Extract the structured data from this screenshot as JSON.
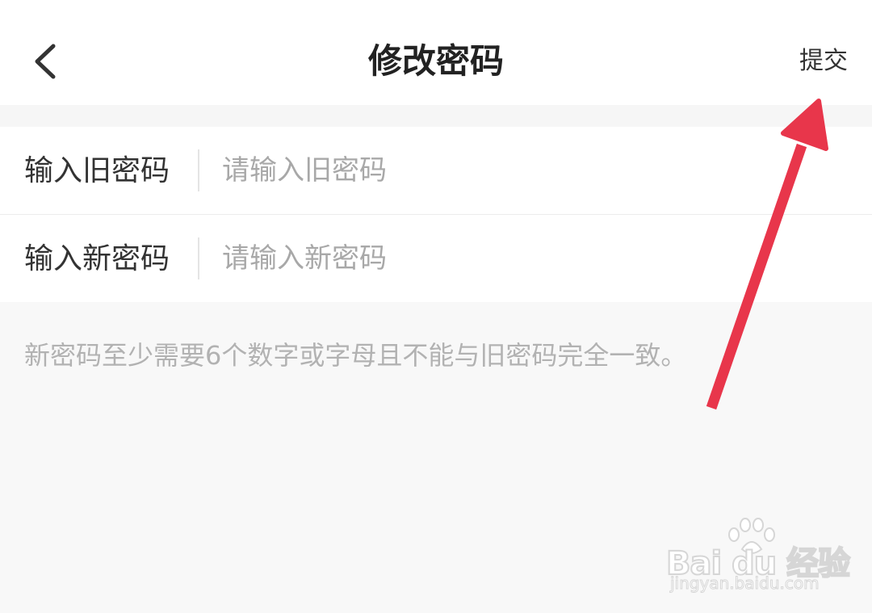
{
  "header": {
    "title": "修改密码",
    "submit_label": "提交",
    "back_icon": "chevron-left-icon"
  },
  "form": {
    "old_password": {
      "label": "输入旧密码",
      "placeholder": "请输入旧密码",
      "value": ""
    },
    "new_password": {
      "label": "输入新密码",
      "placeholder": "请输入新密码",
      "value": ""
    }
  },
  "hint": "新密码至少需要6个数字或字母且不能与旧密码完全一致。",
  "annotation": {
    "arrow_color": "#e8364b",
    "points_to": "submit-button"
  },
  "watermark": {
    "logo_text": "Bai du 经验",
    "url_text": "jingyan.baidu.com"
  },
  "colors": {
    "background": "#f8f8f8",
    "card": "#ffffff",
    "title": "#222222",
    "label": "#333333",
    "placeholder": "#a8a8a8",
    "hint": "#b2b2b2",
    "accent_arrow": "#e8364b"
  }
}
